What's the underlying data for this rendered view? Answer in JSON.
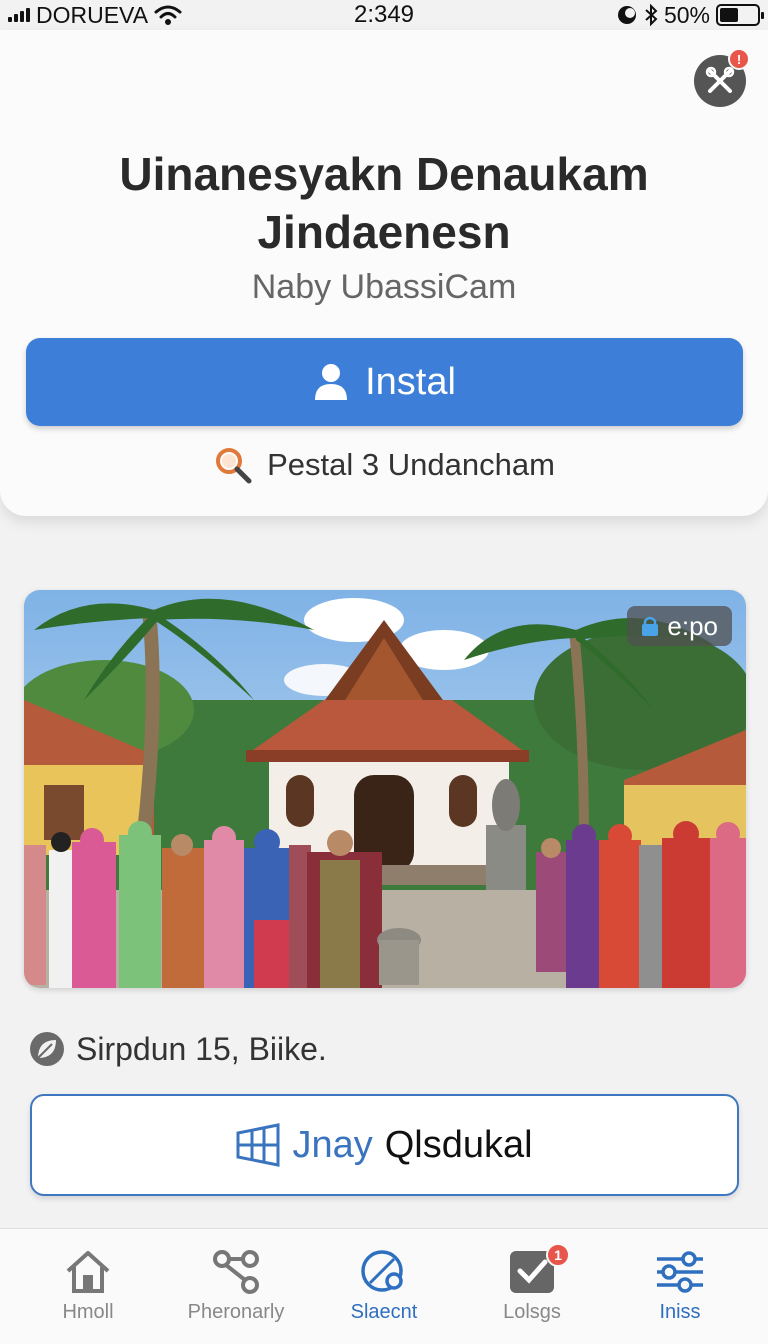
{
  "status_bar": {
    "carrier": "DORUEVA",
    "time": "2:349",
    "battery_text": "50%",
    "battery_level": 0.5
  },
  "app": {
    "title": "Uinanesyakn Denaukam Jindaenesn",
    "subtitle": "Naby UbassiCam",
    "notification_count": "!",
    "install_label": "Instal",
    "search_text": "Pestal 3 Undancham"
  },
  "photo": {
    "badge_text": "e:po"
  },
  "meta": {
    "text": "Sirpdun 15, Biike."
  },
  "action": {
    "label_blue": "Jnay",
    "label_dark": "Qlsdukal"
  },
  "tabs": [
    {
      "label": "Hmoll"
    },
    {
      "label": "Pheronarly"
    },
    {
      "label": "Slaecnt"
    },
    {
      "label": "Lolsgs",
      "badge": "1"
    },
    {
      "label": "Iniss"
    }
  ],
  "colors": {
    "accent": "#3d7ed8",
    "badge": "#e8554a",
    "active_tab": "#2f6fbf"
  }
}
